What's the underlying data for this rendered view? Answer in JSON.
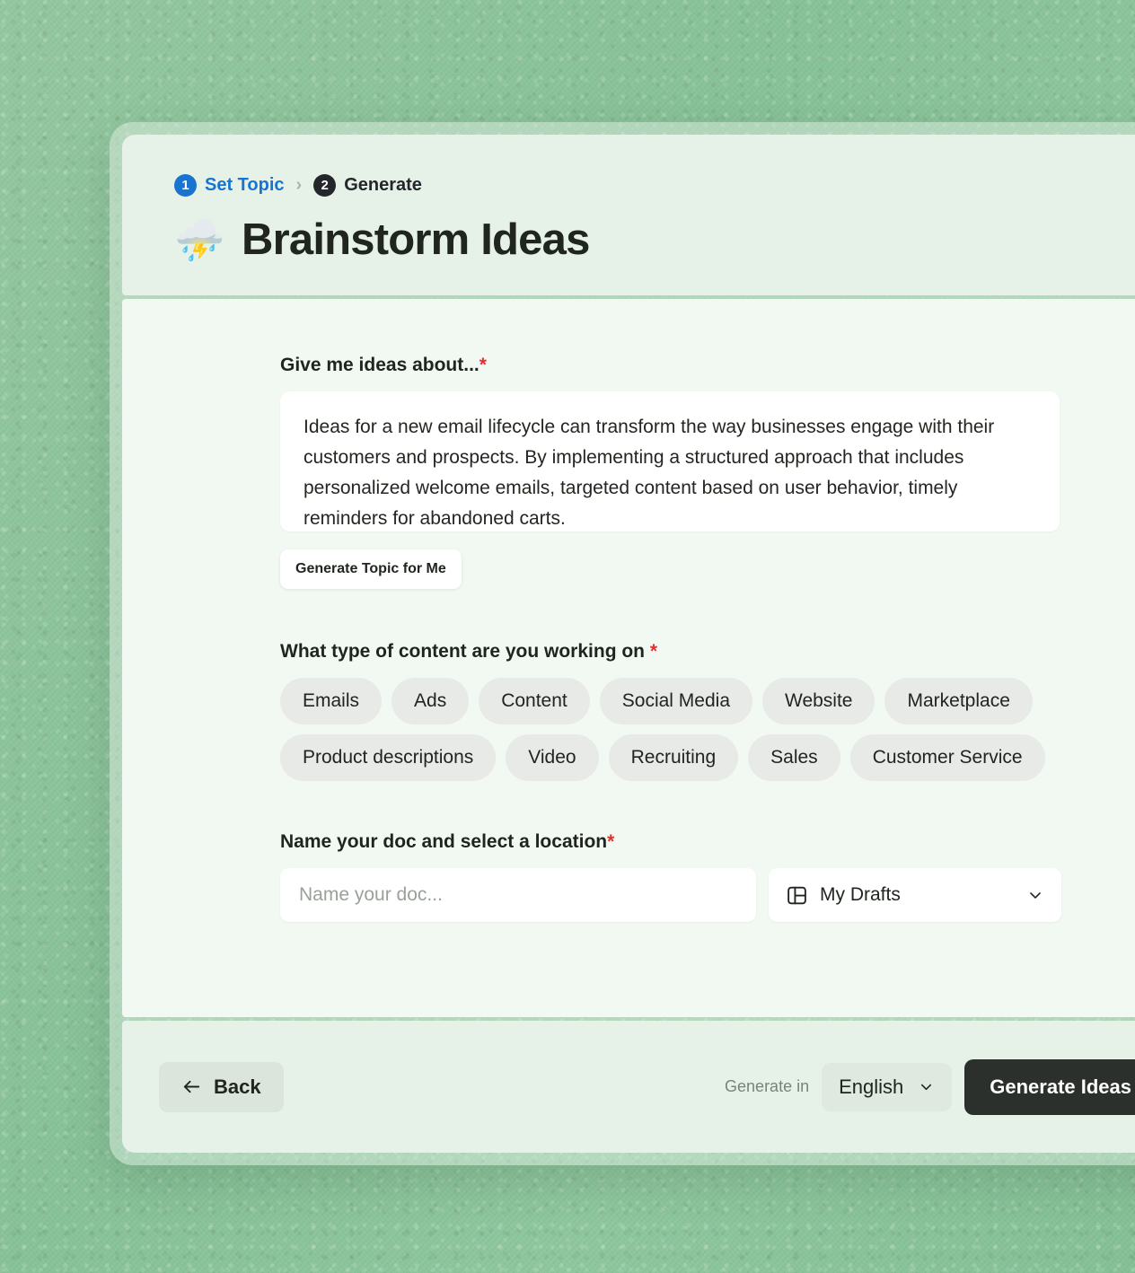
{
  "breadcrumb": {
    "steps": [
      {
        "number": "1",
        "label": "Set Topic",
        "state": "active"
      },
      {
        "number": "2",
        "label": "Generate",
        "state": "next"
      }
    ],
    "separator": "›"
  },
  "header": {
    "emoji": "⛈️",
    "emoji_name": "cloud-with-lightning-icon",
    "title": "Brainstorm Ideas"
  },
  "topic": {
    "label": "Give me ideas about...",
    "required_marker": "*",
    "value": "Ideas for a new email lifecycle can transform the way businesses engage with their customers and prospects. By implementing a structured approach that includes personalized welcome emails, targeted content based on user behavior, timely reminders for abandoned carts.",
    "placeholder": "Give me ideas about...",
    "generate_topic_button": "Generate Topic for Me"
  },
  "content_type": {
    "label": "What type of content are you working on",
    "required_marker": "*",
    "options": [
      "Emails",
      "Ads",
      "Content",
      "Social Media",
      "Website",
      "Marketplace",
      "Product descriptions",
      "Video",
      "Recruiting",
      "Sales",
      "Customer Service"
    ]
  },
  "doc": {
    "label": "Name your doc and select a location",
    "required_marker": "*",
    "name_value": "",
    "name_placeholder": "Name your doc...",
    "location_value": "My Drafts",
    "location_icon": "layout-grid-icon",
    "chevron_icon": "chevron-down-icon"
  },
  "footer": {
    "back_label": "Back",
    "back_icon": "arrow-left-icon",
    "generate_in_label": "Generate in",
    "language_value": "English",
    "language_chevron_icon": "chevron-down-icon",
    "generate_ideas_label": "Generate Ideas"
  },
  "colors": {
    "backdrop": "#8cc49b",
    "card_header": "#e6f1e7",
    "card_body": "#f2f8f2",
    "accent_blue": "#1874cf",
    "required_red": "#e03030",
    "chip_bg": "#e8eae8",
    "primary_button": "#2c302c"
  }
}
